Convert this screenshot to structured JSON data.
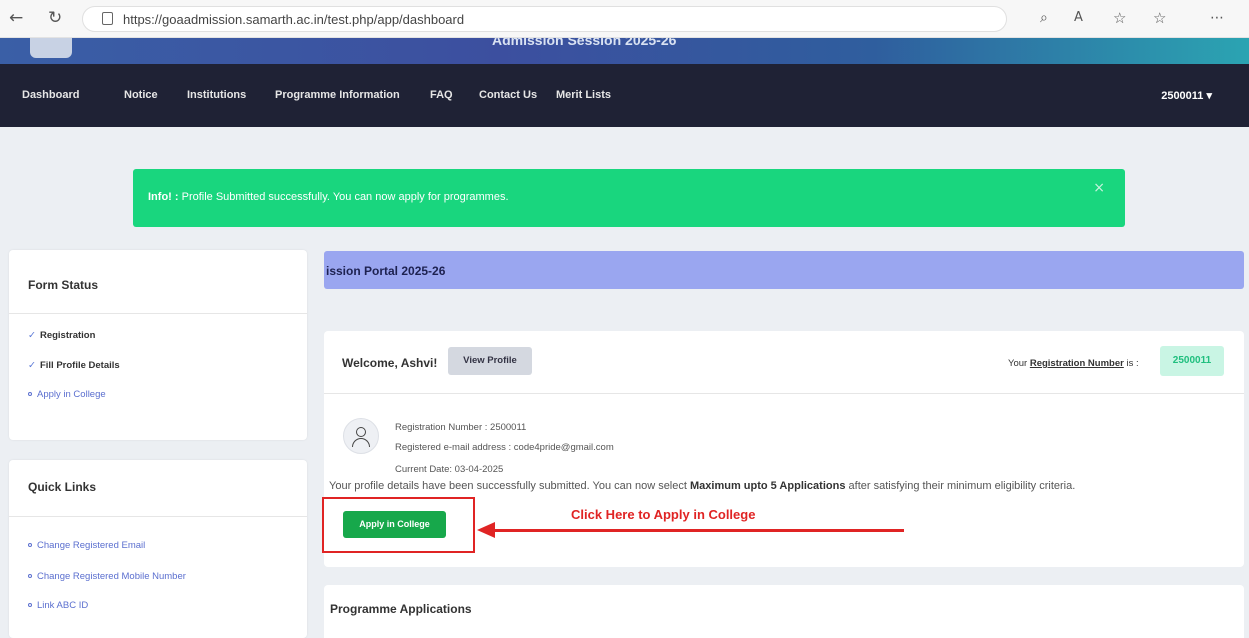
{
  "browser": {
    "url": "https://goaadmission.samarth.ac.in/test.php/app/dashboard",
    "back_icon": "back-arrow-icon",
    "reload_icon": "reload-icon"
  },
  "banner": {
    "title": "Admission Session 2025-26"
  },
  "nav": {
    "items": [
      "Dashboard",
      "Notice",
      "Institutions",
      "Programme Information",
      "FAQ",
      "Contact Us",
      "Merit Lists"
    ],
    "user": "2500011 ▾"
  },
  "alert": {
    "label": "Info! :",
    "message": "Profile Submitted successfully. You can now apply for programmes.",
    "close": "×",
    "color": "#19d67e"
  },
  "form_status": {
    "title": "Form Status",
    "items": [
      {
        "label": "Registration",
        "done": true
      },
      {
        "label": "Fill Profile Details",
        "done": true
      },
      {
        "label": "Apply in College",
        "done": false
      }
    ]
  },
  "quick_links": {
    "title": "Quick Links",
    "items": [
      "Change Registered Email",
      "Change Registered Mobile Number",
      "Link ABC ID"
    ]
  },
  "portal": {
    "title": "ission Portal 2025-26"
  },
  "welcome": {
    "greeting": "Welcome, Ashvi!",
    "view_profile": "View Profile",
    "reg_prefix": "Your",
    "reg_link": "Registration Number",
    "reg_suffix": "is :",
    "reg_number": "2500011"
  },
  "profile": {
    "reg_line": "Registration Number : 2500011",
    "email_line": "Registered e-mail address : code4pride@gmail.com",
    "date_line": "Current Date: 03-04-2025",
    "desc_start": "Your profile details have been successfully submitted. You can now select",
    "desc_bold": "Maximum upto 5 Applications",
    "desc_end": "after satisfying their minimum eligibility criteria."
  },
  "apply": {
    "button": "Apply in College",
    "annotation": "Click Here to Apply in College"
  },
  "programme_applications": {
    "title": "Programme Applications"
  }
}
